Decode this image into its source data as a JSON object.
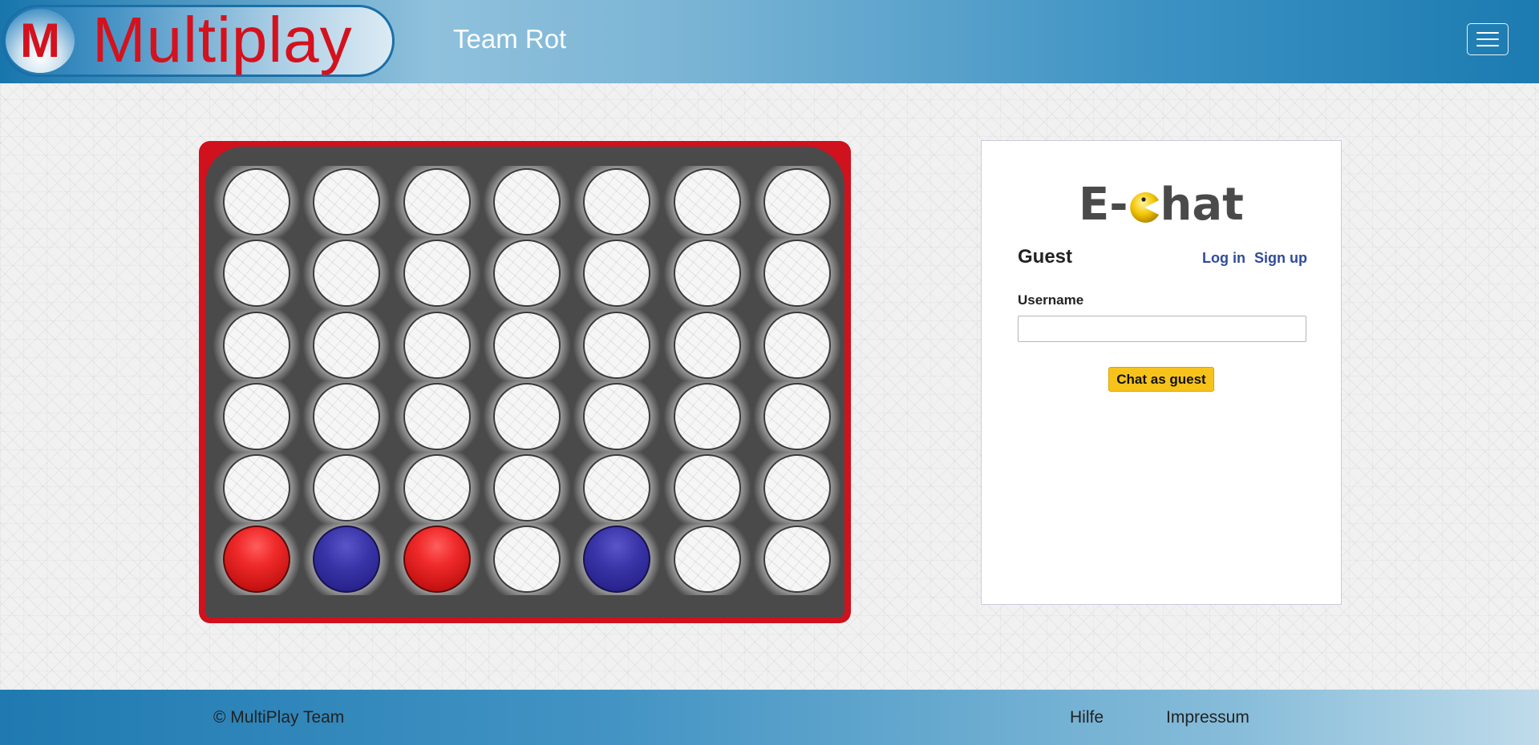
{
  "header": {
    "logo_letter": "M",
    "logo_text": "Multiplay",
    "team_title": "Team Rot",
    "menu_icon": "hamburger-menu-icon"
  },
  "game": {
    "type": "connect-four",
    "columns": 7,
    "rows": 6,
    "colors": {
      "frame": "#d0111e",
      "board": "#4a4a4a",
      "red_disc": "#e52121",
      "blue_disc": "#2e2a9c"
    },
    "board": [
      [
        "",
        "",
        "",
        "",
        "",
        "",
        ""
      ],
      [
        "",
        "",
        "",
        "",
        "",
        "",
        ""
      ],
      [
        "",
        "",
        "",
        "",
        "",
        "",
        ""
      ],
      [
        "",
        "",
        "",
        "",
        "",
        "",
        ""
      ],
      [
        "",
        "",
        "",
        "",
        "",
        "",
        ""
      ],
      [
        "red",
        "blue",
        "red",
        "",
        "blue",
        "",
        ""
      ]
    ]
  },
  "chat": {
    "logo_prefix": "E-",
    "logo_suffix": "hat",
    "logo_icon": "pacman-icon",
    "user_status": "Guest",
    "login_link": "Log in",
    "signup_link": "Sign up",
    "username_label": "Username",
    "username_value": "",
    "guest_button": "Chat as guest"
  },
  "footer": {
    "copyright": "© MultiPlay Team",
    "links": [
      "Hilfe",
      "Impressum"
    ]
  },
  "theme": {
    "accent_red": "#d3121e",
    "header_blue": "#1c7bb1",
    "button_yellow": "#f7c31b",
    "link_blue": "#2f4b9c"
  }
}
